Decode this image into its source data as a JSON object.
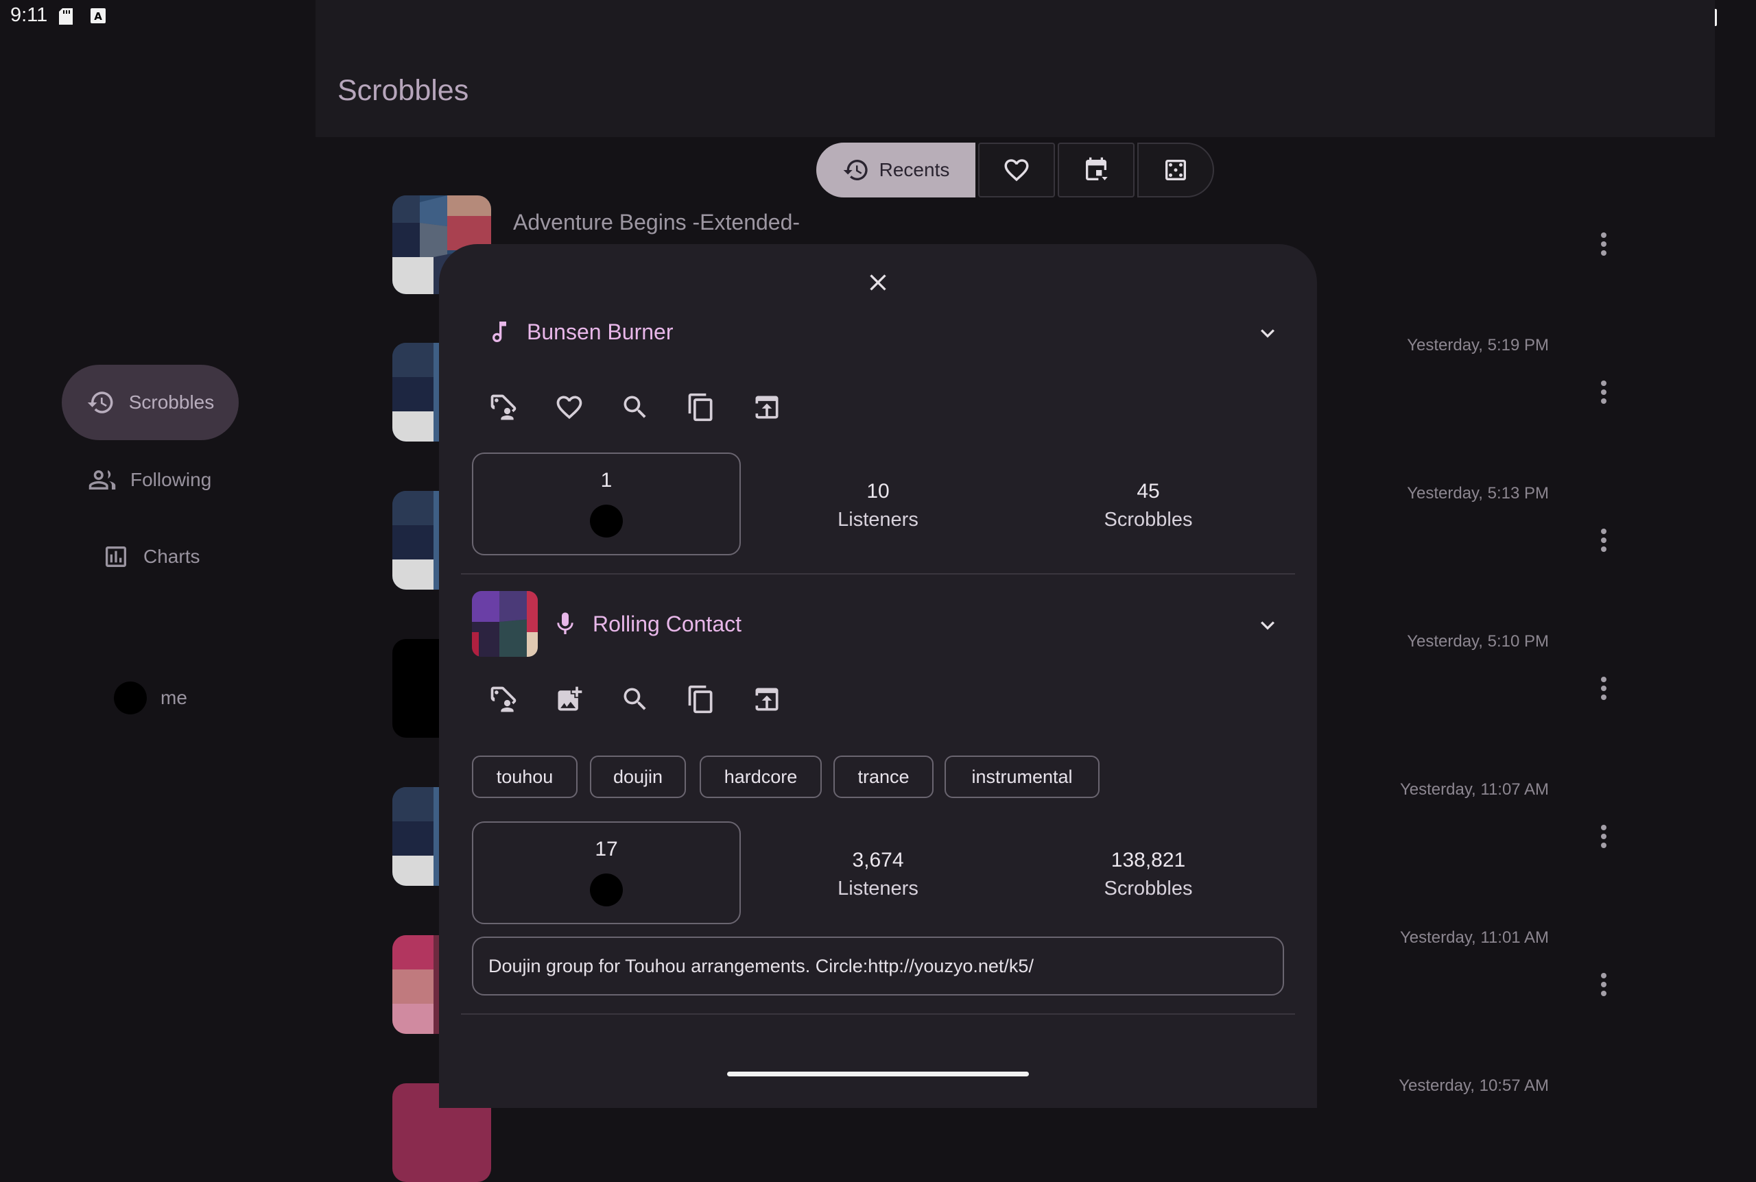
{
  "status_bar": {
    "time": "9:11"
  },
  "app_bar": {
    "title": "Scrobbles"
  },
  "nav": {
    "items": [
      {
        "label": "Scrobbles",
        "icon": "history-icon",
        "selected": true
      },
      {
        "label": "Following",
        "icon": "people-icon"
      },
      {
        "label": "Charts",
        "icon": "bar-chart-icon"
      }
    ],
    "profile": {
      "label": "me"
    }
  },
  "segments": {
    "recents_label": "Recents",
    "loved_icon": "heart-icon",
    "calendar_icon": "calendar-icon",
    "random_icon": "dice-icon"
  },
  "scrobbles": [
    {
      "title": "Adventure Begins -Extended-",
      "time": ""
    },
    {
      "title": "",
      "time": "Yesterday, 5:19 PM"
    },
    {
      "title": "",
      "time": "Yesterday, 5:13 PM"
    },
    {
      "title": "",
      "time": "Yesterday, 5:10 PM"
    },
    {
      "title": "",
      "time": "Yesterday, 11:07 AM"
    },
    {
      "title": "",
      "time": "Yesterday, 11:01 AM"
    },
    {
      "title": "",
      "time": "Yesterday, 10:57 AM"
    }
  ],
  "sheet": {
    "track": {
      "name": "Bunsen Burner",
      "user_plays": "1",
      "listeners": "10",
      "listeners_label": "Listeners",
      "scrobbles": "45",
      "scrobbles_label": "Scrobbles",
      "actions": [
        "tag-user-icon",
        "heart-icon",
        "search-icon",
        "copy-icon",
        "share-icon"
      ]
    },
    "artist": {
      "name": "Rolling Contact",
      "user_plays": "17",
      "listeners": "3,674",
      "listeners_label": "Listeners",
      "scrobbles": "138,821",
      "scrobbles_label": "Scrobbles",
      "tags": [
        "touhou",
        "doujin",
        "hardcore",
        "trance",
        "instrumental"
      ],
      "bio": "Doujin group for Touhou arrangements. Circle:http://youzyo.net/k5/",
      "actions": [
        "tag-user-icon",
        "add-image-icon",
        "search-icon",
        "copy-icon",
        "share-icon"
      ]
    }
  },
  "colors": {
    "accent": "#e8b7e9",
    "background": "#141216",
    "sheet": "#221f26",
    "selected_segment": "#b8aeb8"
  }
}
